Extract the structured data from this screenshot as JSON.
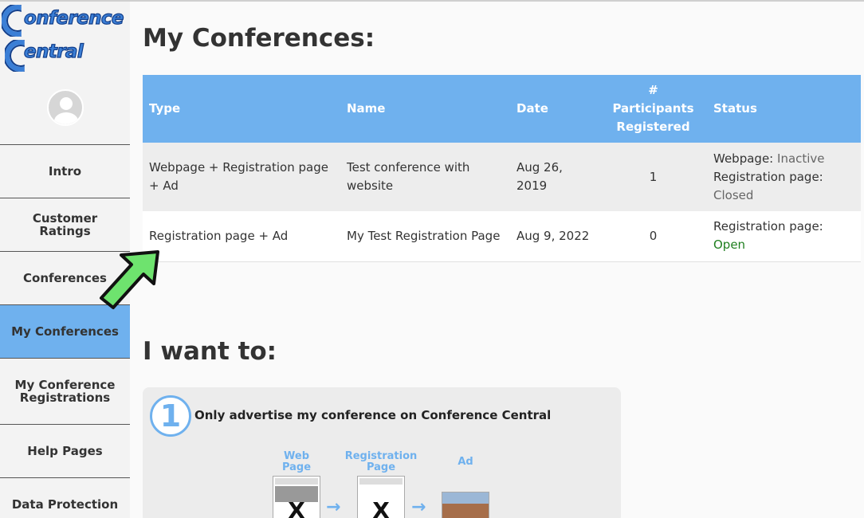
{
  "logo": {
    "line1": "onference",
    "line2": "entral"
  },
  "sidebar": {
    "items": [
      {
        "label": "Intro"
      },
      {
        "label": "Customer Ratings"
      },
      {
        "label": "Conferences"
      },
      {
        "label": "My Conferences",
        "active": true
      },
      {
        "label": "My Conference Registrations"
      },
      {
        "label": "Help Pages"
      },
      {
        "label": "Data Protection"
      }
    ]
  },
  "main": {
    "title": "My Conferences:",
    "table": {
      "headers": [
        "Type",
        "Name",
        "Date",
        "# Participants Registered",
        "Status"
      ],
      "header_part": {
        "line1": "#",
        "line2": "Participants",
        "line3": "Registered"
      },
      "rows": [
        {
          "type": "Webpage + Registration page + Ad",
          "name": "Test conference with website",
          "date": "Aug 26, 2019",
          "participants": "1",
          "status": {
            "webpage_label": "Webpage:",
            "webpage_value": "Inactive",
            "reg_label": "Registration page:",
            "reg_value": "Closed"
          }
        },
        {
          "type": "Registration page + Ad",
          "name": "My Test Registration Page",
          "date": "Aug 9, 2022",
          "participants": "0",
          "status": {
            "reg_label": "Registration page:",
            "reg_value": "Open"
          }
        }
      ]
    },
    "want_title": "I want to:",
    "option1": {
      "number": "1",
      "title": "Only advertise my conference on Conference Central",
      "steps": [
        {
          "label_l1": "Web",
          "label_l2": "Page",
          "mark": "X"
        },
        {
          "label_l1": "Registration",
          "label_l2": "Page",
          "mark": "X"
        },
        {
          "label_l1": "Ad",
          "label_l2": ""
        }
      ]
    }
  },
  "colors": {
    "accent": "#6fb1ee",
    "open": "#1f7f1f",
    "arrow": "#6ee36e"
  }
}
